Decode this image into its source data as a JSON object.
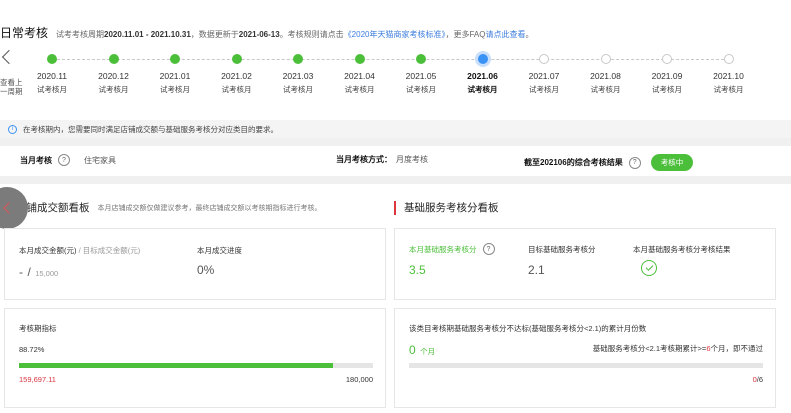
{
  "header": {
    "title": "日常考核",
    "desc_prefix": "试考考核周期",
    "period": "2020.11.01 - 2021.10.31",
    "desc_mid": "，数据更新于",
    "updated": "2021-06-13",
    "desc_rule": "。考核规则请点击",
    "rule_link": "《2020年天猫商家考核标准》",
    "desc_faq": "，更多FAQ",
    "faq_link": "请点此查看",
    "desc_end": "。"
  },
  "timeline": {
    "prev_label": "查看上一周期",
    "months": [
      {
        "label": "2020.11",
        "sub": "试考核月",
        "state": "done"
      },
      {
        "label": "2020.12",
        "sub": "试考核月",
        "state": "done"
      },
      {
        "label": "2021.01",
        "sub": "试考核月",
        "state": "done"
      },
      {
        "label": "2021.02",
        "sub": "试考核月",
        "state": "done"
      },
      {
        "label": "2021.03",
        "sub": "试考核月",
        "state": "done"
      },
      {
        "label": "2021.04",
        "sub": "试考核月",
        "state": "done"
      },
      {
        "label": "2021.05",
        "sub": "试考核月",
        "state": "done"
      },
      {
        "label": "2021.06",
        "sub": "试考核月",
        "state": "current"
      },
      {
        "label": "2021.07",
        "sub": "试考核月",
        "state": "future"
      },
      {
        "label": "2021.08",
        "sub": "试考核月",
        "state": "future"
      },
      {
        "label": "2021.09",
        "sub": "试考核月",
        "state": "future"
      },
      {
        "label": "2021.10",
        "sub": "试考核月",
        "state": "future"
      }
    ]
  },
  "notice": {
    "text": "在考核期内，您需要同时满足店铺成交额与基础服务考核分对应类目的要求。"
  },
  "summary": {
    "month_exam_label": "当月考核",
    "category": "住宅家具",
    "method_label": "当月考核方式：",
    "method_value": "月度考核",
    "result_label": "截至202106的综合考核结果",
    "result_value": "考核中"
  },
  "left_section": {
    "title": "店铺成交额看板",
    "note": "本月店铺成交额仅做建议参考，最终店铺成交额以考核期指标进行考核。",
    "monthly_amount_label": "本月成交金额(元)",
    "target_label": "/ 目标成交金额(元)",
    "amount_value": "-",
    "slash": "/",
    "target_value": "15,000",
    "progress_label": "本月成交进度",
    "progress_value": "0%",
    "period_metric_label": "考核期指标",
    "period_percent": "88.72%",
    "period_fraction": 0.8872,
    "current_value": "159,697.11",
    "target_total": "180,000"
  },
  "right_section": {
    "title": "基础服务考核分看板",
    "score_label": "本月基础服务考核分",
    "score_value": "3.5",
    "target_label": "目标基础服务考核分",
    "target_value": "2.1",
    "result_label": "本月基础服务考核分考核结果",
    "fail_months_label": "该类目考核期基础服务考核分不达标(基础服务考核分<2.1)的累计月份数",
    "fail_months_value": "0",
    "month_unit": "个月",
    "rule_prefix": "基础服务考核分<2.1考核期累计>=",
    "rule_number": "6",
    "rule_suffix": "个月，即不通过",
    "ratio_current": "0",
    "ratio_total": "/6",
    "ratio_fraction": 0
  }
}
